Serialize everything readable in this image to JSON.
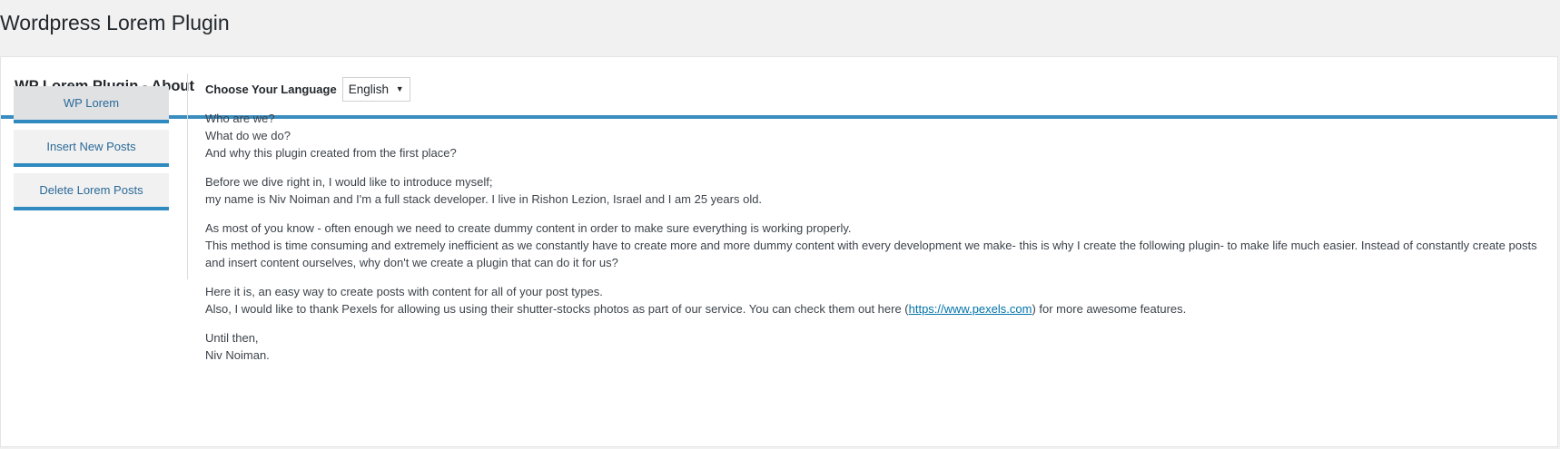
{
  "page": {
    "title": "Wordpress Lorem Plugin"
  },
  "card": {
    "title": "WP Lorem Plugin - About"
  },
  "sidebar": {
    "items": [
      {
        "label": "WP Lorem",
        "active": true
      },
      {
        "label": "Insert New Posts",
        "active": false
      },
      {
        "label": "Delete Lorem Posts",
        "active": false
      }
    ]
  },
  "language": {
    "label": "Choose Your Language",
    "selected": "English"
  },
  "about": {
    "p1": [
      "Who are we?",
      "What do we do?",
      "And why this plugin created from the first place?"
    ],
    "p2": [
      "Before we dive right in, I would like to introduce myself;",
      "my name is Niv Noiman and I'm a full stack developer. I live in Rishon Lezion, Israel and I am 25 years old."
    ],
    "p3": [
      "As most of you know - often enough we need to create dummy content in order to make sure everything is working properly.",
      "This method is time consuming and extremely inefficient as we constantly have to create more and more dummy content with every development we make- this is why I create the following plugin- to make life much easier. Instead of constantly create posts and insert content ourselves, why don't we create a plugin that can do it for us?"
    ],
    "p4": {
      "line1": "Here it is, an easy way to create posts with content for all of your post types.",
      "line2_before": "Also, I would like to thank Pexels for allowing us using their shutter-stocks photos as part of our service. You can check them out here (",
      "link": "https://www.pexels.com",
      "line2_after": ") for more awesome features."
    },
    "p5": [
      "Until then,",
      "Niv Noiman."
    ]
  },
  "colors": {
    "accent": "#3a8dbf",
    "link": "#0073aa",
    "background": "#f1f1f1"
  }
}
